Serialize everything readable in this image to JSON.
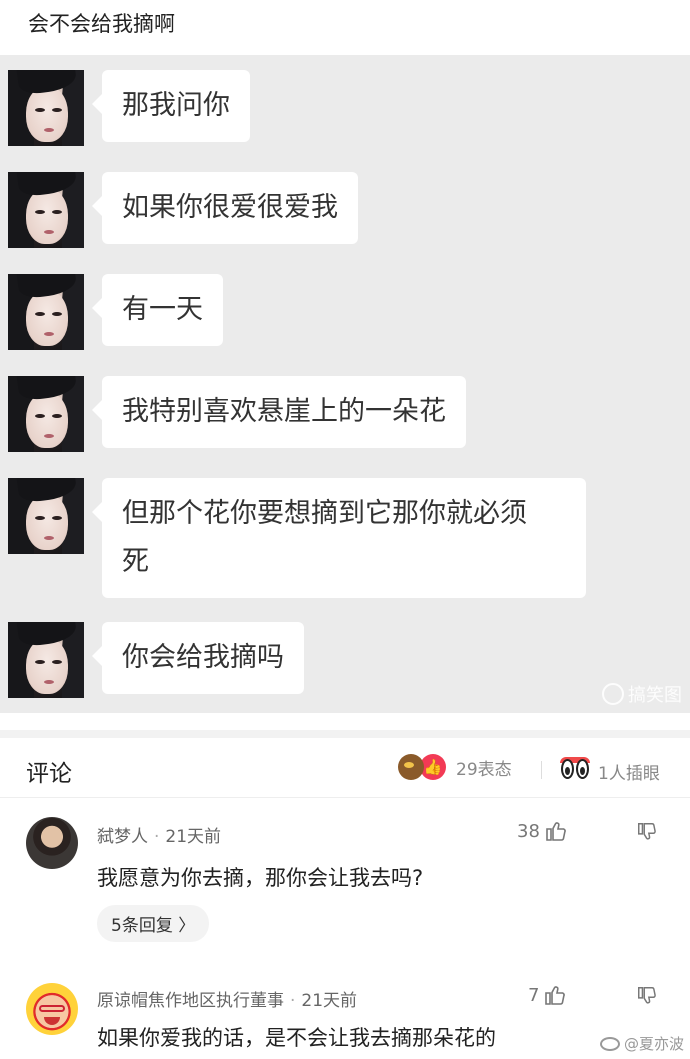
{
  "post": {
    "title": "会不会给我摘啊"
  },
  "chat": {
    "messages": [
      {
        "text": "那我问你"
      },
      {
        "text": "如果你很爱很爱我"
      },
      {
        "text": "有一天"
      },
      {
        "text": "我特别喜欢悬崖上的一朵花"
      },
      {
        "text": "但那个花你要想摘到它那你就必须\n死"
      },
      {
        "text": "你会给我摘吗"
      }
    ],
    "watermark": "搞笑图"
  },
  "comments_header": {
    "title": "评论",
    "reaction_count": "29表态",
    "peek_count": "1人插眼"
  },
  "comments": [
    {
      "username": "弑梦人",
      "time": "21天前",
      "likes": "38",
      "text": "我愿意为你去摘，那你会让我去吗?",
      "replies": "5条回复 〉"
    },
    {
      "username": "原谅帽焦作地区执行董事",
      "time": "21天前",
      "likes": "7",
      "text": "如果你爱我的话，是不会让我去摘那朵花的"
    }
  ],
  "footer": {
    "watermark": "@夏亦波"
  }
}
